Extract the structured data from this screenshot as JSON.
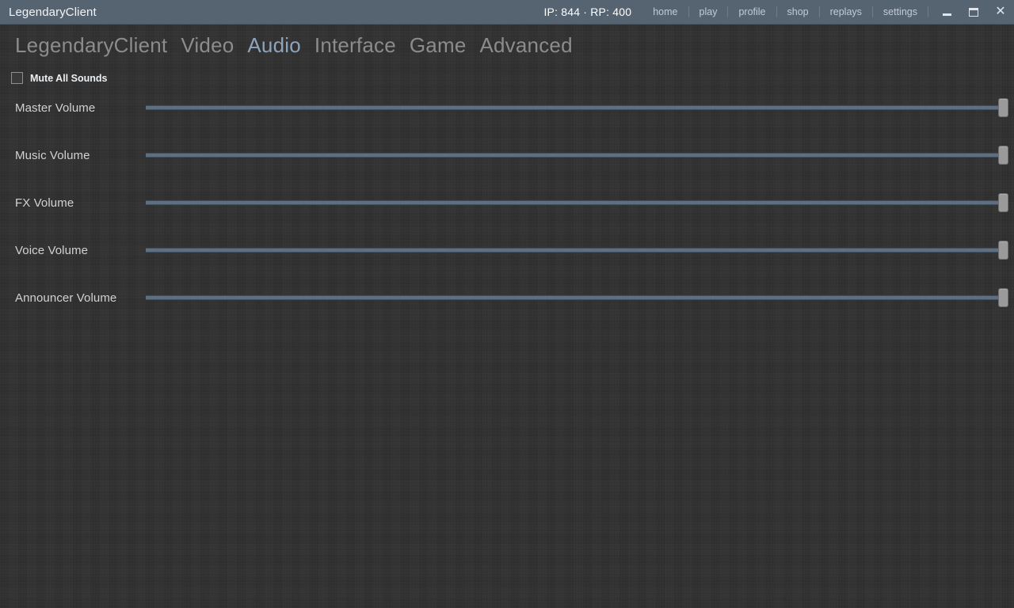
{
  "titlebar": {
    "app_title": "LegendaryClient",
    "currency": "IP: 844 · RP: 400",
    "nav": [
      {
        "label": "home"
      },
      {
        "label": "play"
      },
      {
        "label": "profile"
      },
      {
        "label": "shop"
      },
      {
        "label": "replays"
      },
      {
        "label": "settings"
      }
    ],
    "window_controls": {
      "minimize": "minimize-icon",
      "maximize": "maximize-icon",
      "close": "close-icon"
    }
  },
  "tabs": [
    {
      "label": "LegendaryClient",
      "active": false
    },
    {
      "label": "Video",
      "active": false
    },
    {
      "label": "Audio",
      "active": true
    },
    {
      "label": "Interface",
      "active": false
    },
    {
      "label": "Game",
      "active": false
    },
    {
      "label": "Advanced",
      "active": false
    }
  ],
  "audio_settings": {
    "mute_all": {
      "label": "Mute All Sounds",
      "checked": false
    },
    "sliders": [
      {
        "label": "Master Volume",
        "value": 100,
        "min": 0,
        "max": 100
      },
      {
        "label": "Music Volume",
        "value": 100,
        "min": 0,
        "max": 100
      },
      {
        "label": "FX Volume",
        "value": 100,
        "min": 0,
        "max": 100
      },
      {
        "label": "Voice Volume",
        "value": 100,
        "min": 0,
        "max": 100
      },
      {
        "label": "Announcer Volume",
        "value": 100,
        "min": 0,
        "max": 100
      }
    ]
  },
  "colors": {
    "titlebar_bg": "#566370",
    "page_bg": "#323232",
    "tab_inactive": "#8c8c8c",
    "tab_active": "#8ea4bd",
    "slider_track": "#5f6f82",
    "slider_thumb": "#9a9a9a",
    "label_text": "#d2d2d2"
  }
}
